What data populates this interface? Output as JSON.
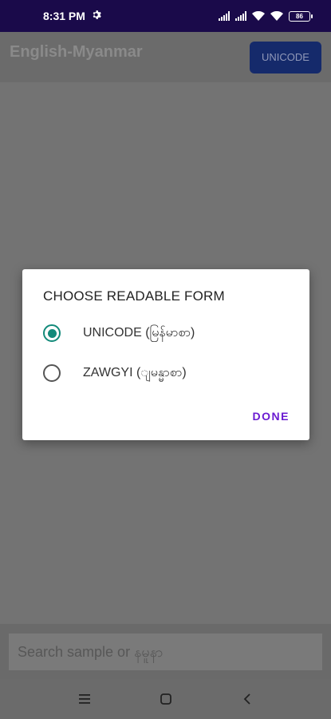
{
  "status_bar": {
    "time": "8:31 PM",
    "battery": "86"
  },
  "app_bar": {
    "title": "English-Myanmar",
    "font_button": "UNICODE"
  },
  "search": {
    "placeholder": "Search sample or နမူနာ"
  },
  "dialog": {
    "title": "CHOOSE READABLE FORM",
    "options": [
      {
        "label": "UNICODE (မြန်မာစာ)",
        "selected": true
      },
      {
        "label": "ZAWGYI (ျမန္မာစာ)",
        "selected": false
      }
    ],
    "done_label": "DONE"
  },
  "colors": {
    "accent_radio": "#138a7a",
    "done_text": "#6a1bd1",
    "status_bar": "#1a0a4a"
  },
  "icons": {
    "status": [
      "settings-gear-icon",
      "signal-icon",
      "signal-icon",
      "wifi-icon",
      "wifi-icon",
      "battery-icon"
    ],
    "nav": [
      "menu-icon",
      "home-icon",
      "back-icon"
    ]
  }
}
